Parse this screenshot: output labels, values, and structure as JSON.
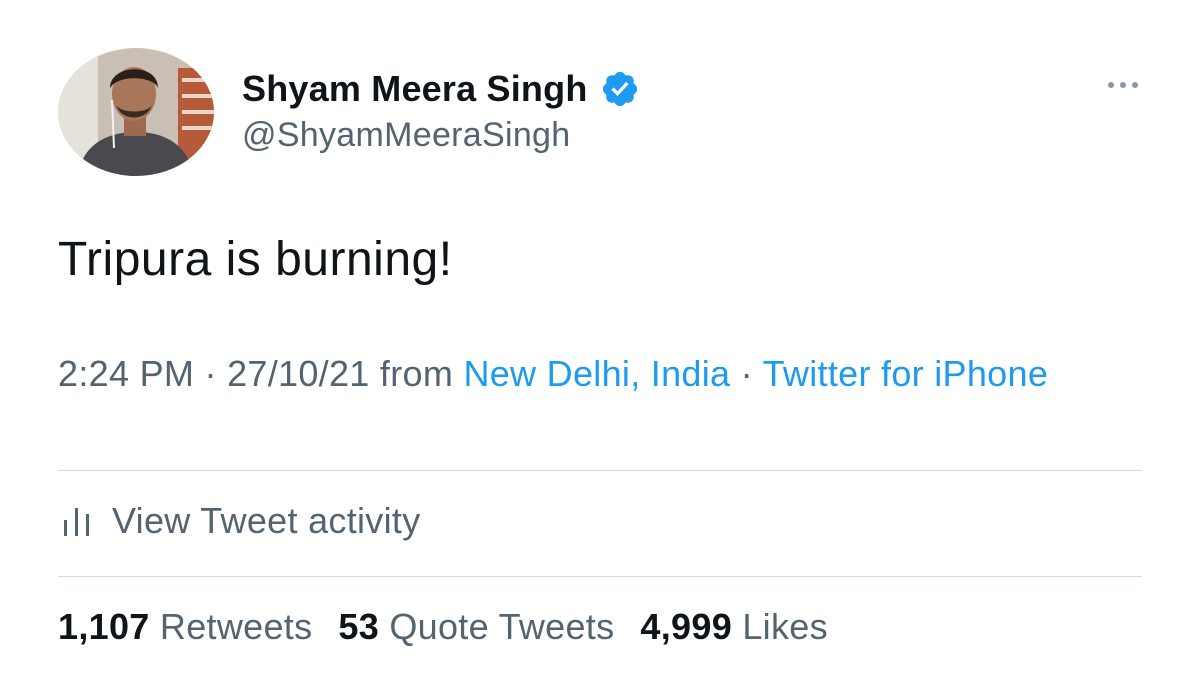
{
  "author": {
    "display_name": "Shyam Meera Singh",
    "handle": "@ShyamMeeraSingh",
    "verified": true,
    "avatar_icon": "profile-photo"
  },
  "tweet": {
    "text": "Tripura is burning!"
  },
  "meta": {
    "time": "2:24 PM",
    "separator1": " · ",
    "date": "27/10/21",
    "from": " from ",
    "location": "New Delhi, India",
    "separator2": " · ",
    "source": "Twitter for iPhone"
  },
  "activity": {
    "label": "View Tweet activity",
    "icon": "bar-chart-icon"
  },
  "stats": {
    "retweets_count": "1,107",
    "retweets_label": "Retweets",
    "quotes_count": "53",
    "quotes_label": "Quote Tweets",
    "likes_count": "4,999",
    "likes_label": "Likes"
  },
  "colors": {
    "link": "#1d9bf0",
    "secondary_text": "#536471",
    "primary_text": "#0f1419",
    "divider": "#cfd9de"
  }
}
